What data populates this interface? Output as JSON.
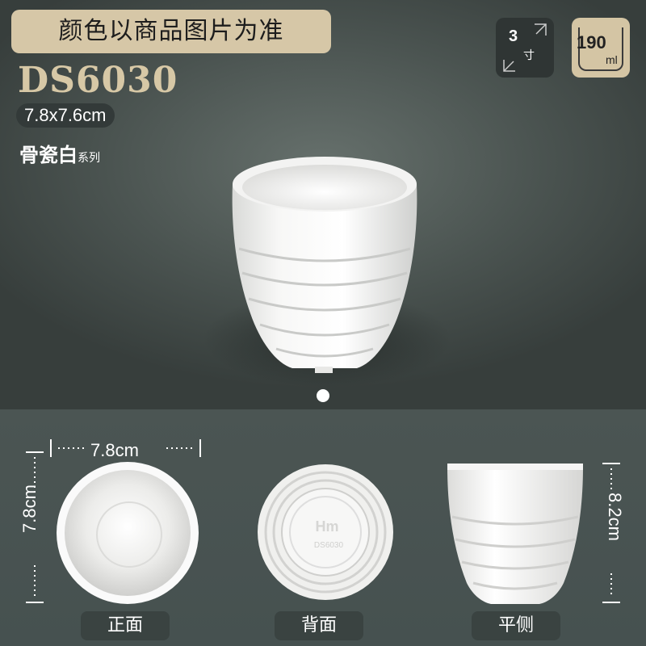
{
  "banner": {
    "text": "颜色以商品图片为准"
  },
  "product": {
    "model": "DS6030",
    "size": "7.8x7.6cm",
    "series_main": "骨瓷白",
    "series_sub": "系列"
  },
  "badges": {
    "size_badge": {
      "num": "3",
      "unit": "寸",
      "icon": "resize-arrows-icon"
    },
    "volume_badge": {
      "num": "190",
      "unit": "ml",
      "icon": "cup-volume-icon"
    }
  },
  "carousel": {
    "current": 1
  },
  "views": {
    "front": {
      "label": "正面",
      "width_label": "7.8cm",
      "height_label": "7.8cm"
    },
    "back": {
      "label": "背面",
      "stamp_logo": "Hm",
      "stamp_code": "DS6030"
    },
    "side": {
      "label": "平侧",
      "height_label": "8.2cm"
    }
  },
  "colors": {
    "accent": "#d6c7a7",
    "background": "#4b5451",
    "cup": "#f4f4f2"
  }
}
